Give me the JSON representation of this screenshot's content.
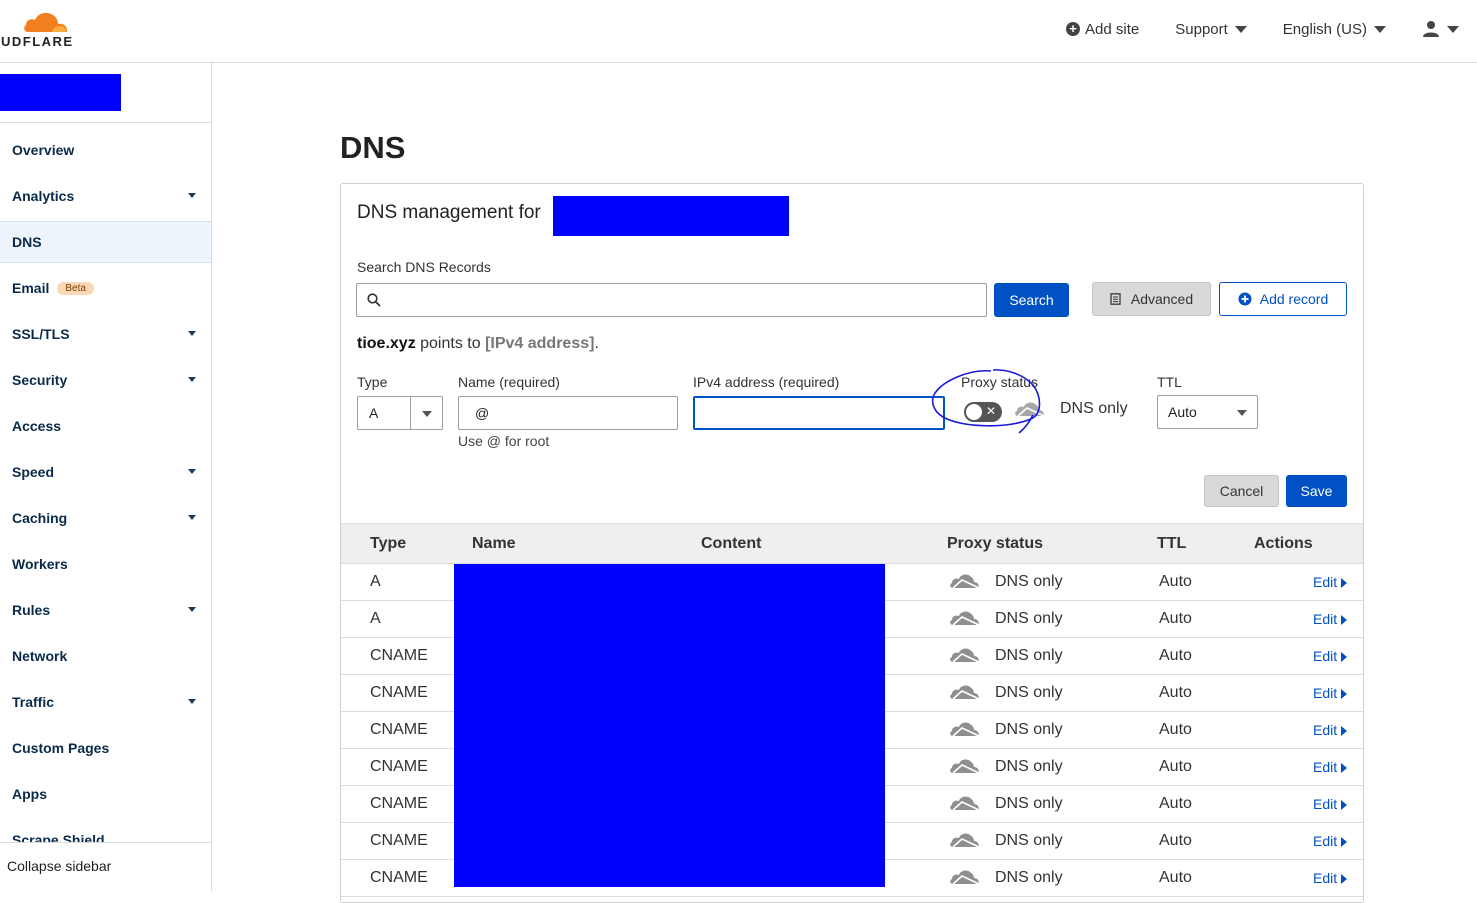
{
  "header": {
    "logo_text": "UDFLARE",
    "add_site": "Add site",
    "support": "Support",
    "language": "English (US)"
  },
  "sidebar": {
    "items": [
      {
        "label": "Overview",
        "caret": false
      },
      {
        "label": "Analytics",
        "caret": true
      },
      {
        "label": "DNS",
        "caret": false,
        "active": true
      },
      {
        "label": "Email",
        "caret": false,
        "badge": "Beta"
      },
      {
        "label": "SSL/TLS",
        "caret": true
      },
      {
        "label": "Security",
        "caret": true
      },
      {
        "label": "Access",
        "caret": false
      },
      {
        "label": "Speed",
        "caret": true
      },
      {
        "label": "Caching",
        "caret": true
      },
      {
        "label": "Workers",
        "caret": false
      },
      {
        "label": "Rules",
        "caret": true
      },
      {
        "label": "Network",
        "caret": false
      },
      {
        "label": "Traffic",
        "caret": true
      },
      {
        "label": "Custom Pages",
        "caret": false
      },
      {
        "label": "Apps",
        "caret": false
      },
      {
        "label": "Scrape Shield",
        "caret": false
      }
    ],
    "collapse": "Collapse sidebar"
  },
  "main": {
    "title": "DNS",
    "panel_title": "DNS management for",
    "search_label": "Search DNS Records",
    "search_button": "Search",
    "advanced_button": "Advanced",
    "add_record_button": "Add record",
    "points_to": {
      "domain": "tioe.xyz",
      "middle": " points to ",
      "target": "[IPv4 address]",
      "end": "."
    },
    "form": {
      "type_label": "Type",
      "type_value": "A",
      "name_label": "Name (required)",
      "name_value": "@",
      "name_hint": "Use @ for root",
      "ipv4_label": "IPv4 address (required)",
      "ipv4_value": "",
      "proxy_label": "Proxy status",
      "proxy_text": "DNS only",
      "ttl_label": "TTL",
      "ttl_value": "Auto",
      "cancel": "Cancel",
      "save": "Save"
    },
    "table": {
      "headers": [
        "Type",
        "Name",
        "Content",
        "Proxy status",
        "TTL",
        "Actions"
      ],
      "rows": [
        {
          "type": "A",
          "proxy": "DNS only",
          "ttl": "Auto",
          "action": "Edit"
        },
        {
          "type": "A",
          "proxy": "DNS only",
          "ttl": "Auto",
          "action": "Edit"
        },
        {
          "type": "CNAME",
          "proxy": "DNS only",
          "ttl": "Auto",
          "action": "Edit"
        },
        {
          "type": "CNAME",
          "proxy": "DNS only",
          "ttl": "Auto",
          "action": "Edit"
        },
        {
          "type": "CNAME",
          "proxy": "DNS only",
          "ttl": "Auto",
          "action": "Edit"
        },
        {
          "type": "CNAME",
          "proxy": "DNS only",
          "ttl": "Auto",
          "action": "Edit"
        },
        {
          "type": "CNAME",
          "proxy": "DNS only",
          "ttl": "Auto",
          "action": "Edit"
        },
        {
          "type": "CNAME",
          "proxy": "DNS only",
          "ttl": "Auto",
          "action": "Edit"
        },
        {
          "type": "CNAME",
          "proxy": "DNS only",
          "ttl": "Auto",
          "action": "Edit"
        }
      ]
    }
  },
  "colors": {
    "brand_orange": "#f38020",
    "primary_blue": "#0051c3",
    "redaction": "#0000ff",
    "annotation_ink": "#1a1ad6"
  }
}
